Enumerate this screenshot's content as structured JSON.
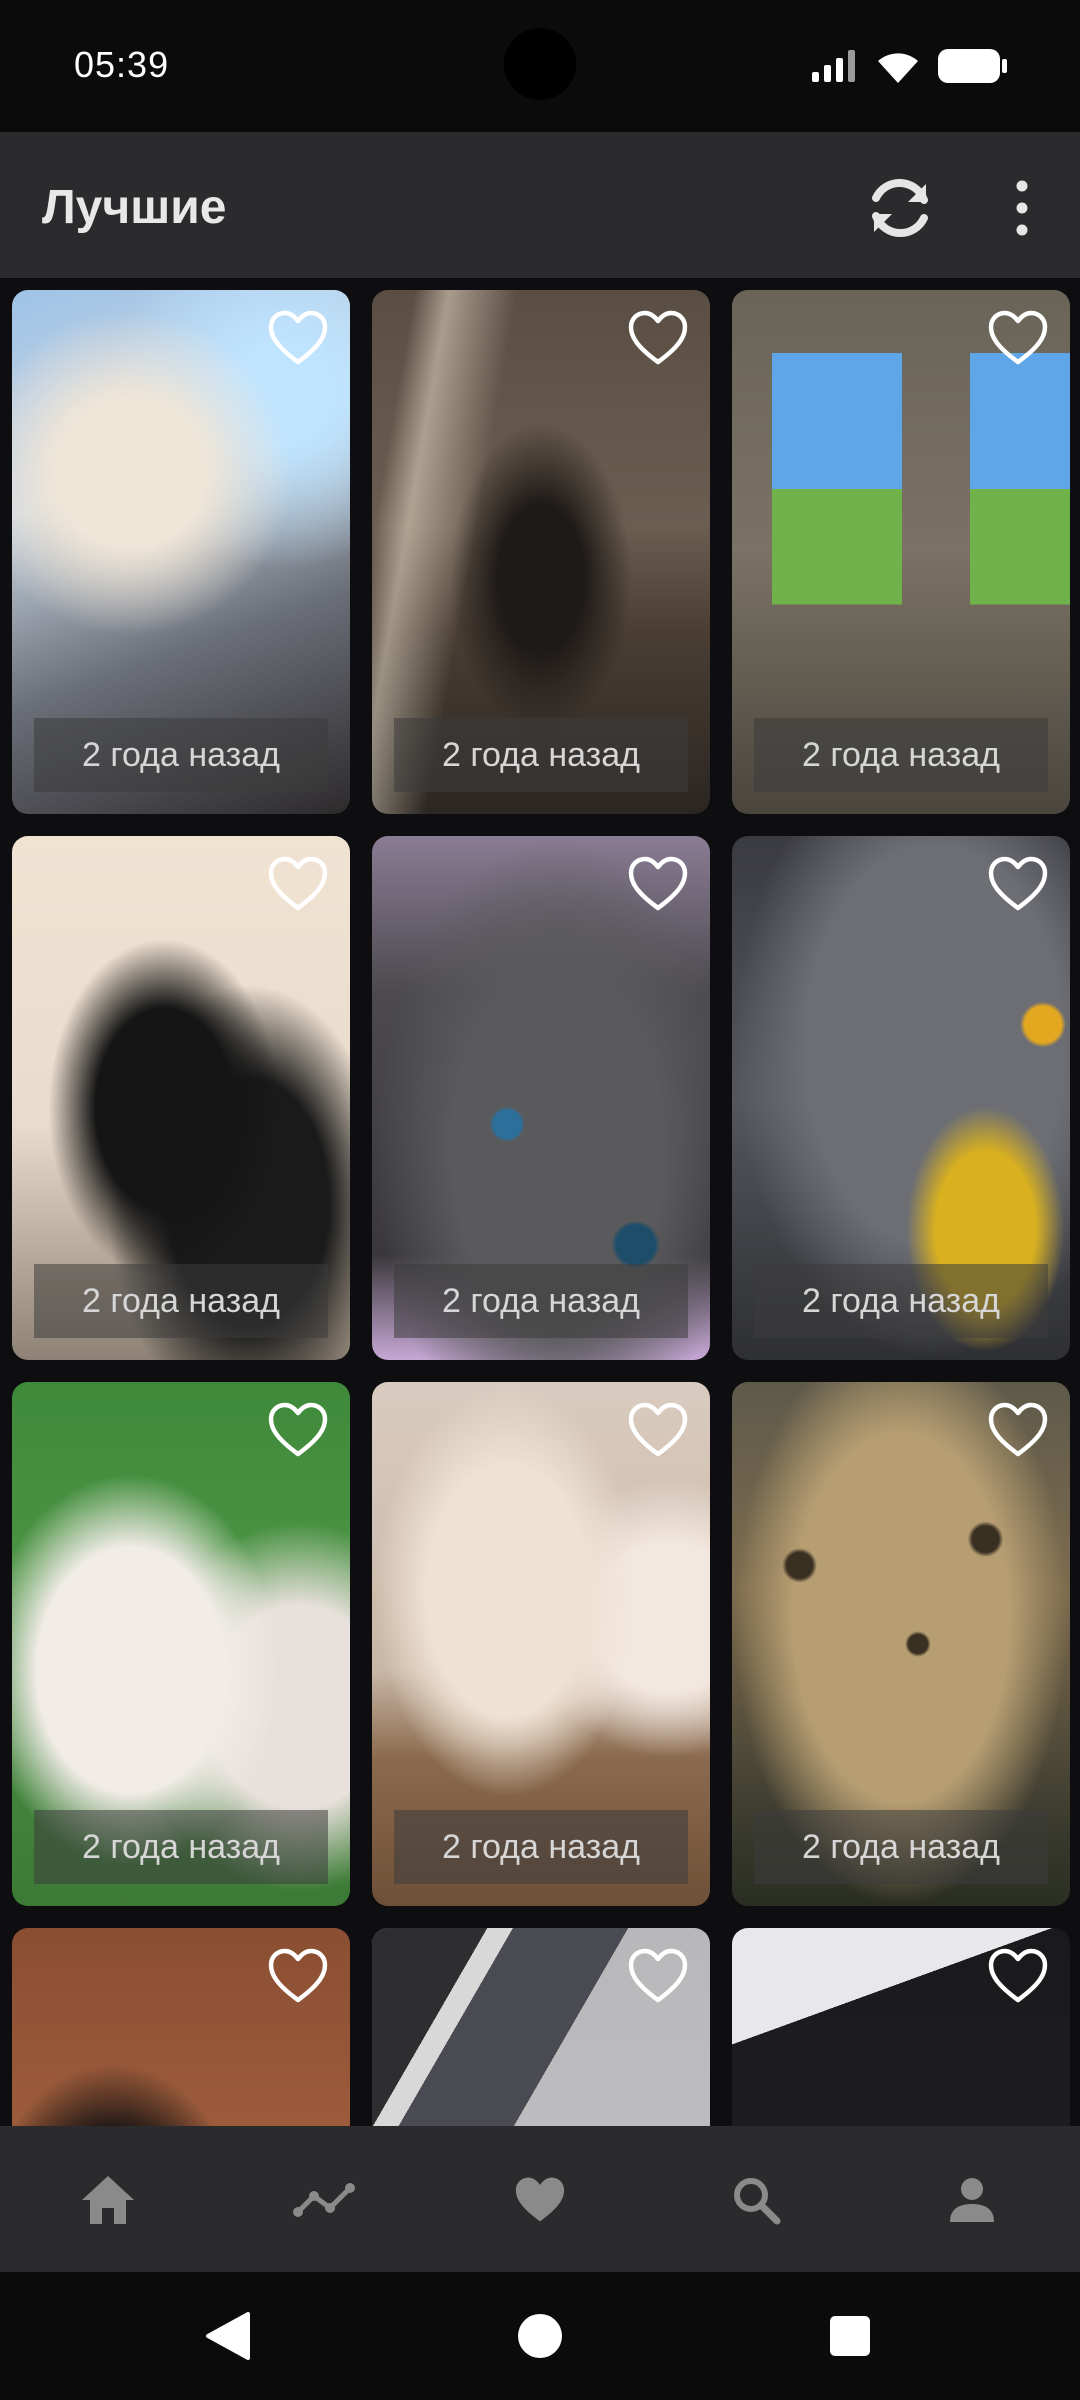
{
  "status": {
    "time": "05:39"
  },
  "app_bar": {
    "title": "Лучшие"
  },
  "cards": [
    {
      "age": "2 года назад",
      "theme": "fantasy-blonde"
    },
    {
      "age": "2 года назад",
      "theme": "winged-warrior"
    },
    {
      "age": "2 года назад",
      "theme": "framed-pictures"
    },
    {
      "age": "2 года назад",
      "theme": "black-kitten"
    },
    {
      "age": "2 года назад",
      "theme": "grey-kitten-blue-eyes"
    },
    {
      "age": "2 года назад",
      "theme": "grey-cat-bowtie"
    },
    {
      "age": "2 года назад",
      "theme": "white-kittens"
    },
    {
      "age": "2 года назад",
      "theme": "kittens-basket"
    },
    {
      "age": "2 года назад",
      "theme": "leopard-cubs"
    },
    {
      "age": "",
      "theme": "stockings"
    },
    {
      "age": "",
      "theme": "photos"
    },
    {
      "age": "",
      "theme": "butterfly"
    }
  ],
  "bottom_nav": [
    "home-icon",
    "trending-icon",
    "favorites-icon",
    "search-icon",
    "profile-icon"
  ],
  "colors": {
    "app_bar": "#2b2b2d",
    "background": "#0e0e10",
    "icon_inactive": "#8a8a8a"
  }
}
